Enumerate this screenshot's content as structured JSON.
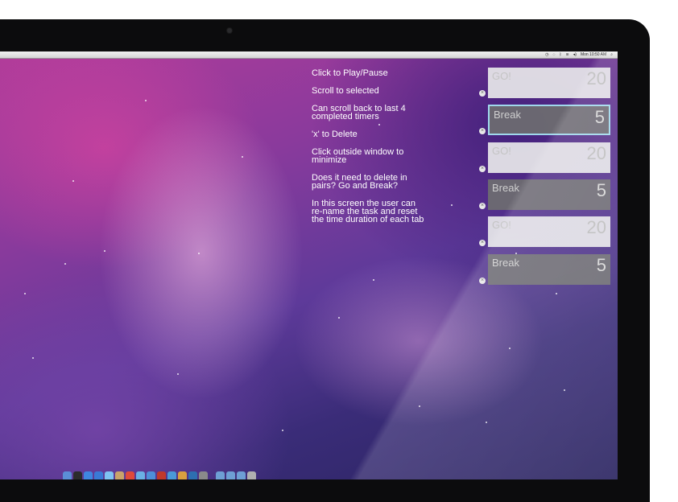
{
  "menubar": {
    "status_icons": [
      "clock-icon",
      "sync-icon",
      "bluetooth-icon",
      "wifi-icon",
      "volume-icon"
    ],
    "clock": "Mon 10:50 AM",
    "search_icon": "search-icon"
  },
  "notes": [
    "Click to Play/Pause",
    "Scroll to selected",
    "Can scroll back to last 4 completed timers",
    "'x' to Delete",
    "Click outside window to minimize",
    "Does it need to delete in pairs? Go and Break?",
    "In this screen the user can re-name the task and reset the time duration of each tab"
  ],
  "timers": [
    {
      "label": "GO!",
      "value": "20",
      "kind": "go",
      "selected": false
    },
    {
      "label": "Break",
      "value": "5",
      "kind": "break",
      "selected": true
    },
    {
      "label": "GO!",
      "value": "20",
      "kind": "go",
      "selected": false
    },
    {
      "label": "Break",
      "value": "5",
      "kind": "break",
      "selected": false
    },
    {
      "label": "GO!",
      "value": "20",
      "kind": "go",
      "selected": false
    },
    {
      "label": "Break",
      "value": "5",
      "kind": "break",
      "selected": false
    }
  ],
  "delete_glyph": "×",
  "dock": {
    "icons": [
      "finder-icon",
      "dashboard-icon",
      "mail-icon",
      "safari-icon",
      "ichat-icon",
      "addressbook-icon",
      "ical-icon",
      "preview-icon",
      "itunes-icon",
      "photobooth-icon",
      "iphoto-icon",
      "garageband-icon",
      "time-machine-icon",
      "system-preferences-icon",
      "applications-folder-icon",
      "documents-folder-icon",
      "downloads-icon",
      "trash-icon"
    ],
    "colors": [
      "#5b8fd6",
      "#2c2c2c",
      "#3f86e0",
      "#3a7ad6",
      "#7ec3f2",
      "#c9a36a",
      "#e04a3a",
      "#6ab0e4",
      "#4e8fd8",
      "#c0392b",
      "#4a9ad8",
      "#d8a040",
      "#2e6fb0",
      "#8a8a8a",
      "#6e9fd4",
      "#6e9fd4",
      "#6e9fd4",
      "#b0b0b0"
    ]
  }
}
